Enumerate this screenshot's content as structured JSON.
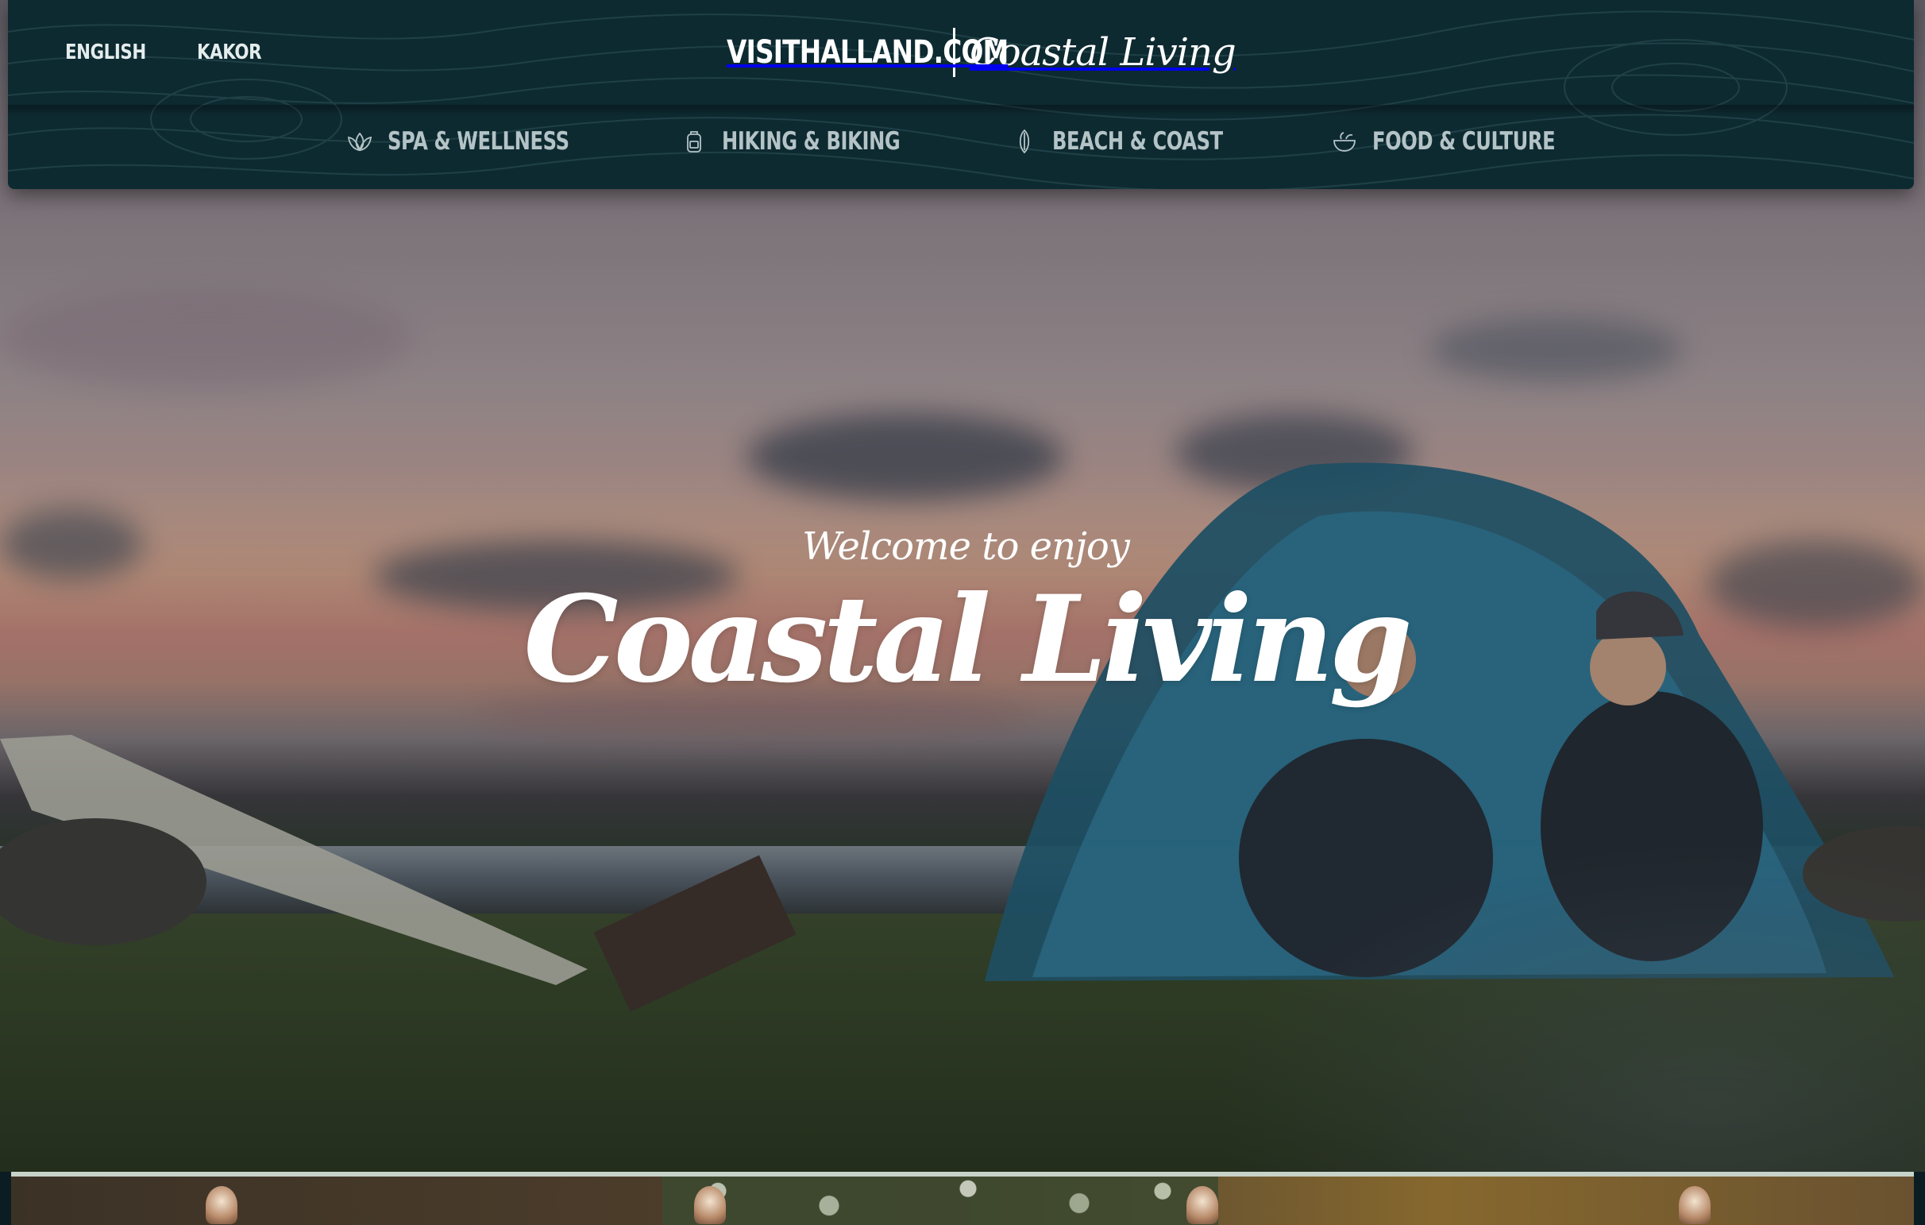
{
  "header": {
    "languages": [
      "ENGLISH",
      "KAKOR"
    ],
    "site_name": "VISITHALLAND.COM",
    "brand_script": "Coastal Living"
  },
  "nav": {
    "items": [
      {
        "label": "SPA & WELLNESS",
        "icon": "lotus-icon"
      },
      {
        "label": "HIKING & BIKING",
        "icon": "backpack-icon"
      },
      {
        "label": "BEACH & COAST",
        "icon": "surfboard-icon"
      },
      {
        "label": "FOOD & CULTURE",
        "icon": "bowl-icon"
      }
    ]
  },
  "hero": {
    "welcome": "Welcome to enjoy",
    "title": "Coastal Living"
  },
  "colors": {
    "header_bg": "#0d2a31",
    "nav_text": "#b4c3c6",
    "text_white": "#ffffff"
  }
}
